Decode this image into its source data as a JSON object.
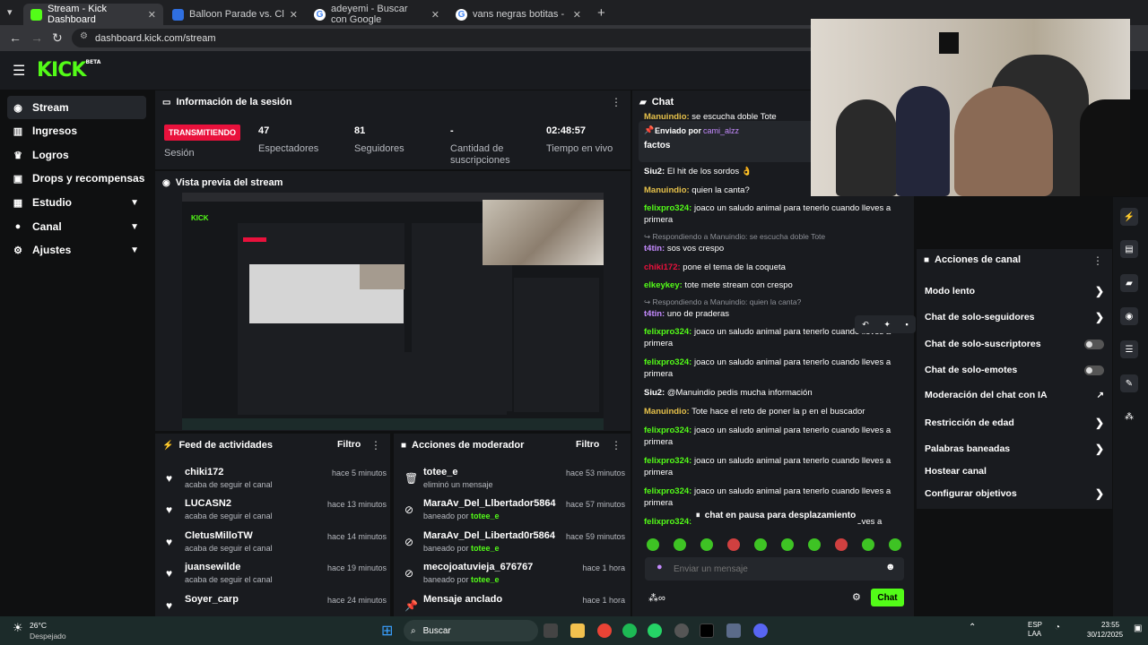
{
  "browser": {
    "tabs": [
      {
        "title": "Stream - Kick Dashboard",
        "color": "#53fc18"
      },
      {
        "title": "Balloon Parade vs. Clash of Cla",
        "color": "#2f6fe0"
      },
      {
        "title": "adeyemi - Buscar con Google",
        "color": "#4285f4"
      },
      {
        "title": "vans negras botitas - Buscar co",
        "color": "#4285f4"
      }
    ],
    "url": "dashboard.kick.com/stream"
  },
  "app": {
    "logo": "KICK",
    "logo_sup": "BETA",
    "brand_color": "#53fc18"
  },
  "sidebar": {
    "items": [
      {
        "label": "Stream",
        "icon": "radio-icon"
      },
      {
        "label": "Ingresos",
        "icon": "bank-icon"
      },
      {
        "label": "Logros",
        "icon": "trophy-icon"
      },
      {
        "label": "Drops y recompensas",
        "icon": "gift-icon"
      },
      {
        "label": "Estudio",
        "icon": "grid-icon"
      },
      {
        "label": "Canal",
        "icon": "person-icon"
      },
      {
        "label": "Ajustes",
        "icon": "gear-icon"
      }
    ]
  },
  "session": {
    "title": "Información de la sesión",
    "live_badge": "TRANSMITIENDO",
    "session_label": "Sesión",
    "viewers": "47",
    "viewers_label": "Espectadores",
    "followers": "81",
    "followers_label": "Seguidores",
    "subs": "-",
    "subs_label": "Cantidad de suscripciones",
    "uptime": "02:48:57",
    "uptime_label": "Tiempo en vivo"
  },
  "preview": {
    "title": "Vista previa del stream"
  },
  "feed": {
    "title": "Feed de actividades",
    "filter": "Filtro",
    "rows": [
      {
        "name": "chiki172",
        "sub": "acaba de seguir el canal",
        "time": "hace 5 minutos"
      },
      {
        "name": "LUCASN2",
        "sub": "acaba de seguir el canal",
        "time": "hace 13 minutos"
      },
      {
        "name": "CletusMilloTW",
        "sub": "acaba de seguir el canal",
        "time": "hace 14 minutos"
      },
      {
        "name": "juansewilde",
        "sub": "acaba de seguir el canal",
        "time": "hace 19 minutos"
      },
      {
        "name": "Soyer_carp",
        "sub": "",
        "time": "hace 24 minutos"
      }
    ]
  },
  "mod": {
    "title": "Acciones de moderador",
    "filter": "Filtro",
    "rows": [
      {
        "name": "totee_e",
        "sub": "eliminó un mensaje",
        "by": "",
        "time": "hace 53 minutos",
        "icon": "trash-icon"
      },
      {
        "name": "MaraAv_Del_Llbertador5864",
        "sub": "baneado por ",
        "by": "totee_e",
        "time": "hace 57 minutos",
        "icon": "ban-icon"
      },
      {
        "name": "MaraAv_Del_Libertad0r5864",
        "sub": "baneado por ",
        "by": "totee_e",
        "time": "hace 59 minutos",
        "icon": "ban-icon"
      },
      {
        "name": "mecojoatuvieja_676767",
        "sub": "baneado por ",
        "by": "totee_e",
        "time": "hace 1 hora",
        "icon": "ban-icon"
      },
      {
        "name": "Mensaje anclado",
        "sub": "",
        "by": "",
        "time": "hace 1 hora",
        "icon": "pin-icon"
      }
    ]
  },
  "chat": {
    "title": "Chat",
    "pinned_prefix": "Enviado por",
    "pinned_user": "cami_alzz",
    "pinned_text": "factos",
    "top_line_user": "Manuindio:",
    "top_line_text": "se escucha doble Tote",
    "messages": [
      {
        "user": "Siu2:",
        "color": "#ffffff",
        "text": " El hit de los sordos 👌",
        "reply": ""
      },
      {
        "user": "Manuindio:",
        "color": "#e6c14a",
        "text": " quien la canta?",
        "reply": ""
      },
      {
        "user": "felixpro324:",
        "color": "#53fc18",
        "text": " joaco un saludo animal para tenerlo cuando lleves a primera",
        "reply": ""
      },
      {
        "user": "t4tin:",
        "color": "#c58bff",
        "text": " sos vos crespo",
        "reply": "Respondiendo a Manuindio: se escucha doble Tote"
      },
      {
        "user": "chiki172:",
        "color": "#e9113c",
        "text": " pone el tema de la coqueta",
        "reply": ""
      },
      {
        "user": "elkeykey:",
        "color": "#53fc18",
        "text": " tote mete stream con crespo",
        "reply": ""
      },
      {
        "user": "t4tin:",
        "color": "#c58bff",
        "text": " uno de praderas",
        "reply": "Respondiendo a Manuindio: quien la canta?"
      },
      {
        "user": "felixpro324:",
        "color": "#53fc18",
        "text": " joaco un saludo animal para tenerlo cuando lleves a primera",
        "reply": ""
      },
      {
        "user": "felixpro324:",
        "color": "#53fc18",
        "text": " joaco un saludo animal para tenerlo cuando lleves a primera",
        "reply": ""
      },
      {
        "user": "Siu2:",
        "color": "#ffffff",
        "text": " @Manuindio pedis mucha información",
        "reply": ""
      },
      {
        "user": "Manuindio:",
        "color": "#e6c14a",
        "text": " Tote hace el reto de poner la p en el buscador",
        "reply": ""
      },
      {
        "user": "felixpro324:",
        "color": "#53fc18",
        "text": " joaco un saludo animal para tenerlo cuando lleves a primera",
        "reply": ""
      },
      {
        "user": "felixpro324:",
        "color": "#53fc18",
        "text": " joaco un saludo animal para tenerlo cuando lleves a primera",
        "reply": ""
      },
      {
        "user": "felixpro324:",
        "color": "#53fc18",
        "text": " joaco un saludo animal para tenerlo cuando lleves a primera",
        "reply": ""
      }
    ],
    "last_line_user": "felixpro324:",
    "last_line_text": "eves a",
    "paused": "chat en pausa para desplazamiento",
    "input_placeholder": "Enviar un mensaje",
    "send_label": "Chat"
  },
  "actions": {
    "title": "Acciones de canal",
    "items": [
      {
        "label": "Modo lento",
        "kind": "arrow"
      },
      {
        "label": "Chat de solo-seguidores",
        "kind": "arrow"
      },
      {
        "label": "Chat de solo-suscriptores",
        "kind": "toggle"
      },
      {
        "label": "Chat de solo-emotes",
        "kind": "toggle"
      },
      {
        "label": "Moderación del chat con IA",
        "kind": "external"
      },
      {
        "label": "Restricción de edad",
        "kind": "arrow"
      },
      {
        "label": "Palabras baneadas",
        "kind": "arrow"
      },
      {
        "label": "Hostear canal",
        "kind": "none"
      },
      {
        "label": "Configurar objetivos",
        "kind": "arrow"
      }
    ]
  },
  "taskbar": {
    "weather_temp": "26°C",
    "weather_text": "Despejado",
    "search": "Buscar",
    "lang": "ESP",
    "lang2": "LAA",
    "time": "23:55",
    "date": "30/12/2025"
  }
}
